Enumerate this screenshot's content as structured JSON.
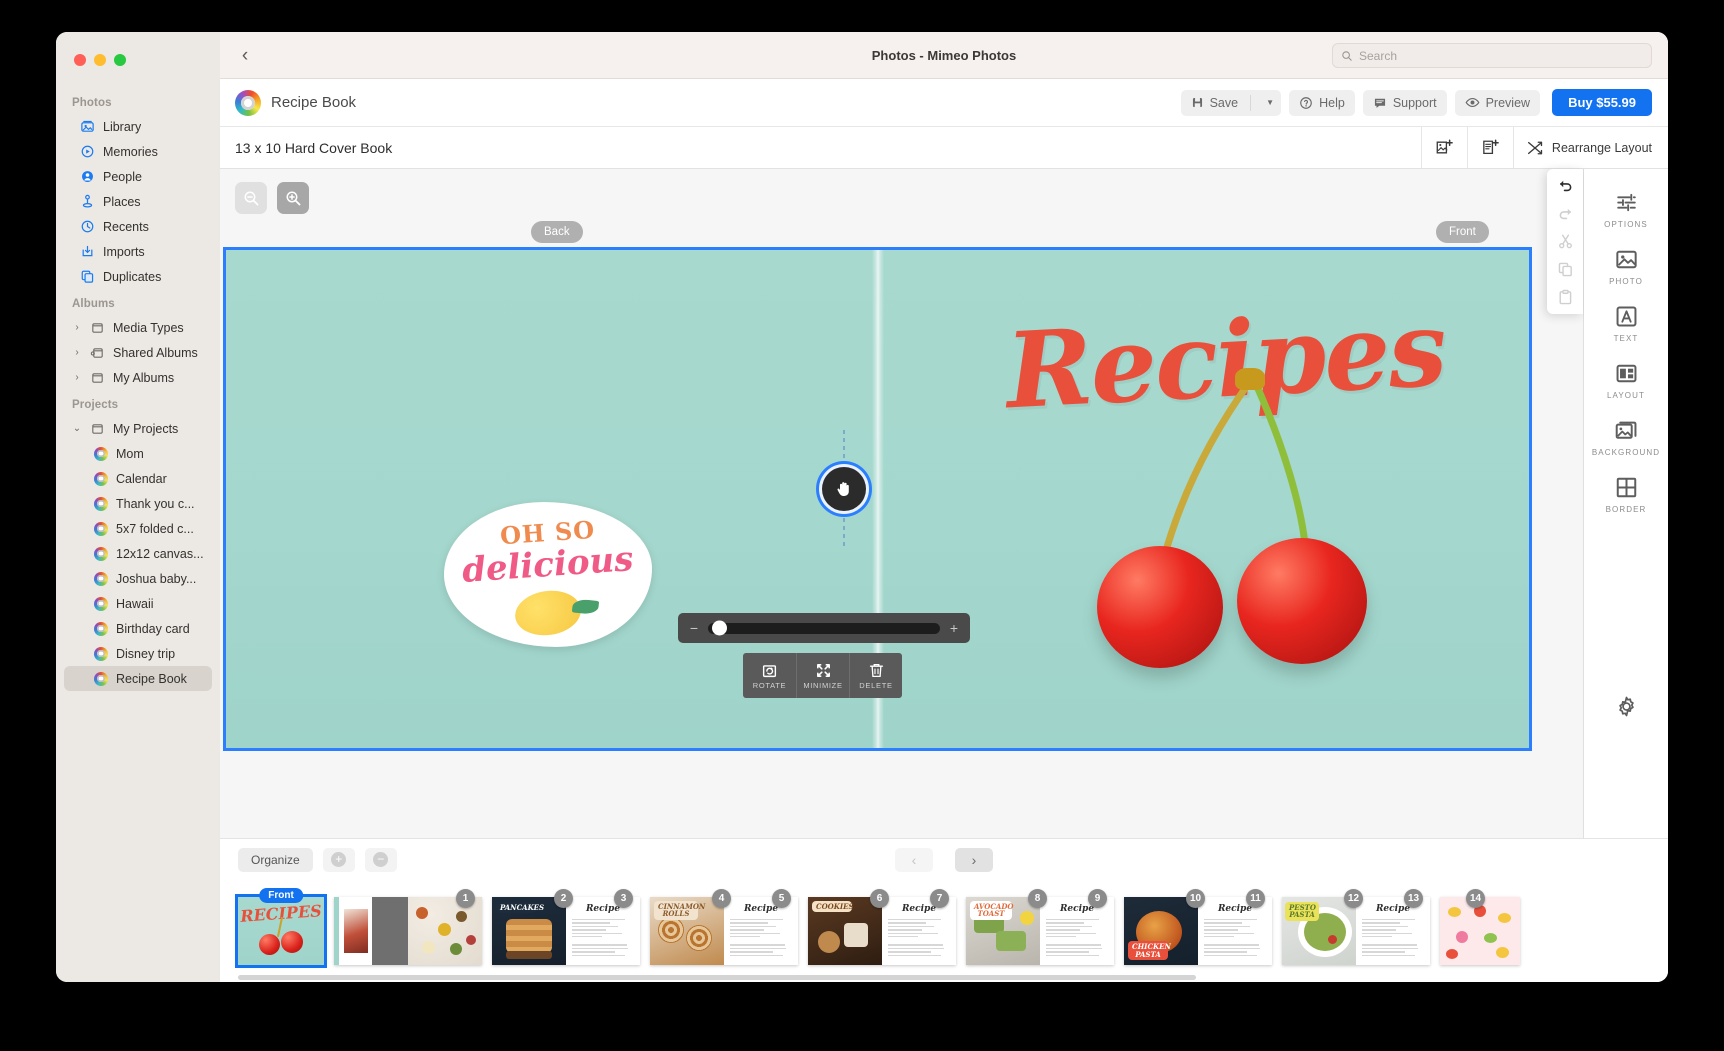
{
  "window": {
    "title": "Photos - Mimeo Photos",
    "back_label": "‹"
  },
  "search": {
    "placeholder": "Search",
    "value": ""
  },
  "sidebar": {
    "sections": [
      {
        "header": "Photos",
        "items": [
          {
            "label": "Library",
            "icon": "library-icon"
          },
          {
            "label": "Memories",
            "icon": "memories-icon"
          },
          {
            "label": "People",
            "icon": "people-icon"
          },
          {
            "label": "Places",
            "icon": "places-icon"
          },
          {
            "label": "Recents",
            "icon": "recents-icon"
          },
          {
            "label": "Imports",
            "icon": "imports-icon"
          },
          {
            "label": "Duplicates",
            "icon": "duplicates-icon"
          }
        ]
      },
      {
        "header": "Albums",
        "items": [
          {
            "label": "Media Types",
            "icon": "folder-icon",
            "chevron": "›"
          },
          {
            "label": "Shared Albums",
            "icon": "shared-folder-icon",
            "chevron": "›"
          },
          {
            "label": "My Albums",
            "icon": "folder-icon",
            "chevron": "›"
          }
        ]
      },
      {
        "header": "Projects",
        "items": [
          {
            "label": "My Projects",
            "icon": "folder-icon",
            "chevron": "⌄"
          }
        ],
        "projects": [
          {
            "label": "Mom",
            "selected": false
          },
          {
            "label": "Calendar",
            "selected": false
          },
          {
            "label": "Thank you c...",
            "selected": false
          },
          {
            "label": "5x7 folded c...",
            "selected": false
          },
          {
            "label": "12x12 canvas...",
            "selected": false
          },
          {
            "label": "Joshua baby...",
            "selected": false
          },
          {
            "label": "Hawaii",
            "selected": false
          },
          {
            "label": "Birthday card",
            "selected": false
          },
          {
            "label": "Disney trip",
            "selected": false
          },
          {
            "label": "Recipe Book",
            "selected": true
          }
        ]
      }
    ]
  },
  "toolbar": {
    "project_name": "Recipe Book",
    "save_label": "Save",
    "help_label": "Help",
    "support_label": "Support",
    "preview_label": "Preview",
    "buy_label": "Buy $55.99",
    "buy_color": "#1272f0"
  },
  "toolbar2": {
    "book_size": "13 x 10 Hard Cover Book",
    "add_photo_icon": "add-photo-icon",
    "add_page_icon": "add-page-icon",
    "rearrange_label": "Rearrange Layout"
  },
  "canvas": {
    "zoom_out_icon": "zoom-out-icon",
    "zoom_in_icon": "zoom-in-icon",
    "back_label": "Back",
    "front_label": "Front",
    "cover": {
      "title_text": "Recipes",
      "sticker_line1": "OH SO",
      "sticker_line2": "delicious"
    },
    "slider": {
      "minus": "−",
      "plus": "+",
      "value": 3
    },
    "context_tools": [
      {
        "label": "ROTATE",
        "icon": "rotate-icon"
      },
      {
        "label": "MINIMIZE",
        "icon": "minimize-icon"
      },
      {
        "label": "DELETE",
        "icon": "trash-icon"
      }
    ],
    "edit_strip": [
      {
        "icon": "undo-icon",
        "enabled": true
      },
      {
        "icon": "redo-icon",
        "enabled": false
      },
      {
        "icon": "cut-icon",
        "enabled": false
      },
      {
        "icon": "copy-icon",
        "enabled": false
      },
      {
        "icon": "paste-icon",
        "enabled": false
      }
    ]
  },
  "tools_rail": {
    "items": [
      {
        "label": "OPTIONS",
        "icon": "sliders-icon"
      },
      {
        "label": "PHOTO",
        "icon": "photo-icon"
      },
      {
        "label": "TEXT",
        "icon": "text-icon"
      },
      {
        "label": "LAYOUT",
        "icon": "layout-icon"
      },
      {
        "label": "BACKGROUND",
        "icon": "background-icon"
      },
      {
        "label": "BORDER",
        "icon": "border-icon"
      }
    ],
    "settings_icon": "gear-icon"
  },
  "bottom_bar": {
    "organize_label": "Organize",
    "add_label": "+",
    "remove_label": "−",
    "prev_label": "‹",
    "next_label": "›"
  },
  "filmstrip": {
    "cover": {
      "badge": "Front",
      "title": "RECIPES"
    },
    "spreads": [
      {
        "left_num": "",
        "right_num": "1",
        "left_kind": "photo-collage",
        "right_kind": "photo-spices",
        "left_sticker": "",
        "right_sticker": ""
      },
      {
        "left_num": "2",
        "right_num": "3",
        "left_kind": "photo-pancakes",
        "right_kind": "recipe-text",
        "left_sticker": "PANCAKES",
        "right_sticker": ""
      },
      {
        "left_num": "4",
        "right_num": "5",
        "left_kind": "photo-cinnamon",
        "right_kind": "recipe-text",
        "left_sticker": "CINNAMON ROLLS",
        "right_sticker": ""
      },
      {
        "left_num": "6",
        "right_num": "7",
        "left_kind": "photo-cookies",
        "right_kind": "recipe-text",
        "left_sticker": "COOKIES",
        "right_sticker": ""
      },
      {
        "left_num": "8",
        "right_num": "9",
        "left_kind": "photo-toast",
        "right_kind": "recipe-text",
        "left_sticker": "AVOCADO TOAST",
        "right_sticker": ""
      },
      {
        "left_num": "10",
        "right_num": "11",
        "left_kind": "photo-pasta-bake",
        "right_kind": "recipe-text",
        "left_sticker": "CHICKEN PASTA",
        "right_sticker": ""
      },
      {
        "left_num": "12",
        "right_num": "13",
        "left_kind": "photo-pesto",
        "right_kind": "recipe-text",
        "left_sticker": "PESTO PASTA",
        "right_sticker": ""
      }
    ],
    "back_cover": {
      "num": "14"
    }
  }
}
